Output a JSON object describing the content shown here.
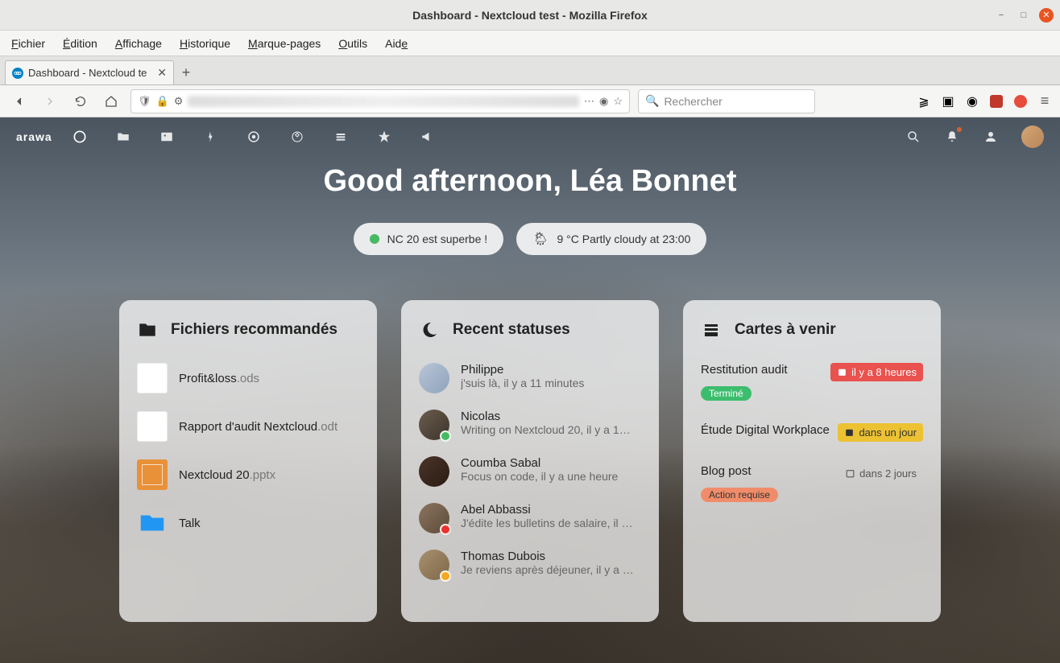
{
  "window": {
    "title": "Dashboard - Nextcloud test - Mozilla Firefox"
  },
  "menubar": [
    "Fichier",
    "Édition",
    "Affichage",
    "Historique",
    "Marque-pages",
    "Outils",
    "Aide"
  ],
  "tab": {
    "title": "Dashboard - Nextcloud te"
  },
  "search_placeholder": "Rechercher",
  "nc": {
    "brand": "arawa"
  },
  "greeting": "Good afternoon, Léa Bonnet",
  "status_pill": "NC 20 est superbe !",
  "weather_pill": "9 °C Partly cloudy at 23:00",
  "widgets": {
    "files": {
      "title": "Fichiers recommandés",
      "items": [
        {
          "name": "Profit&loss",
          "ext": ".ods",
          "thumb": "white"
        },
        {
          "name": "Rapport d'audit Nextcloud",
          "ext": ".odt",
          "thumb": "white"
        },
        {
          "name": "Nextcloud 20",
          "ext": ".pptx",
          "thumb": "orange"
        },
        {
          "name": "Talk",
          "ext": "",
          "thumb": "folder"
        }
      ]
    },
    "statuses": {
      "title": "Recent statuses",
      "items": [
        {
          "name": "Philippe",
          "msg": "j'suis là, il y a 11 minutes",
          "badge": ""
        },
        {
          "name": "Nicolas",
          "msg": "Writing on Nextcloud 20, il y a 1…",
          "badge": "green"
        },
        {
          "name": "Coumba Sabal",
          "msg": "Focus on code, il y a une heure",
          "badge": ""
        },
        {
          "name": "Abel Abbassi",
          "msg": "J'édite les bulletins de salaire, il …",
          "badge": "dnd"
        },
        {
          "name": "Thomas Dubois",
          "msg": "Je reviens après déjeuner, il y a …",
          "badge": "away"
        }
      ]
    },
    "cards": {
      "title": "Cartes à venir",
      "items": [
        {
          "title": "Restitution audit",
          "due": "il y a 8 heures",
          "due_color": "red",
          "label": "Terminé",
          "label_color": "green"
        },
        {
          "title": "Étude Digital Workplace",
          "due": "dans un jour",
          "due_color": "yellow",
          "label": "",
          "label_color": ""
        },
        {
          "title": "Blog post",
          "due": "dans 2 jours",
          "due_color": "plain",
          "label": "Action requise",
          "label_color": "orange"
        }
      ]
    }
  }
}
